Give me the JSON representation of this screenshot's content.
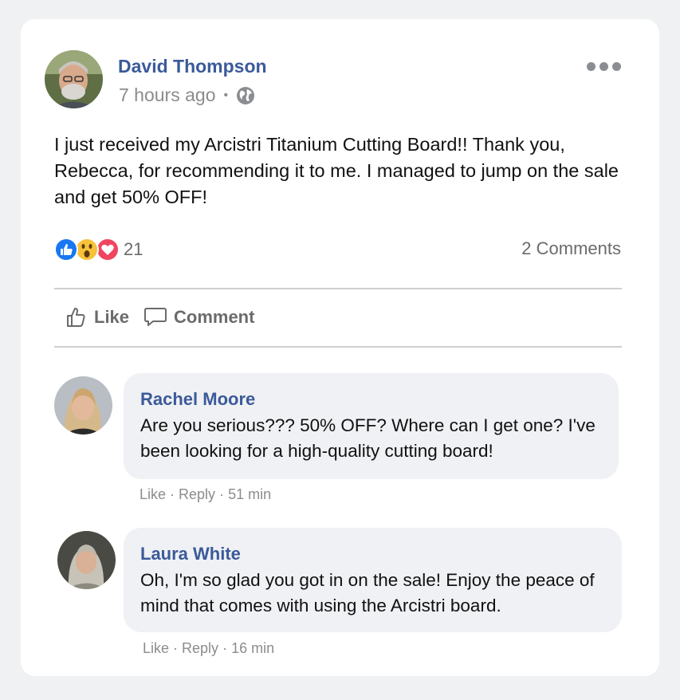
{
  "post": {
    "author": "David Thompson",
    "time": "7 hours ago",
    "separator": "•",
    "privacy_icon": "globe-icon",
    "text": "I just received my Arcistri Titanium Cutting Board!! Thank you, Rebecca, for recommending it to me. I managed to jump on the sale and get 50% OFF!",
    "reactions": [
      "like-reaction-icon",
      "wow-reaction-icon",
      "love-reaction-icon"
    ],
    "reaction_count": "21",
    "comments_count": "2 Comments"
  },
  "actions": {
    "like_label": "Like",
    "comment_label": "Comment"
  },
  "comments": [
    {
      "name": "Rachel Moore",
      "text": "Are you serious??? 50% OFF? Where can I get one? I've been looking for a high-quality cutting board!",
      "like": "Like",
      "sep1": " · ",
      "reply": "Reply",
      "sep2": " · ",
      "time": "51 min"
    },
    {
      "name": "Laura White",
      "text": "Oh, I'm so glad you got in on the sale! Enjoy the peace of mind that comes with using the Arcistri board.",
      "like": "Like",
      "sep1": " · ",
      "reply": "Reply",
      "sep2": " · ",
      "time": "16 min"
    }
  ],
  "colors": {
    "name_blue": "#3b5a9a",
    "like_blue": "#1877f2",
    "wow_yellow": "#f7c23a",
    "love_red": "#f0455e"
  }
}
